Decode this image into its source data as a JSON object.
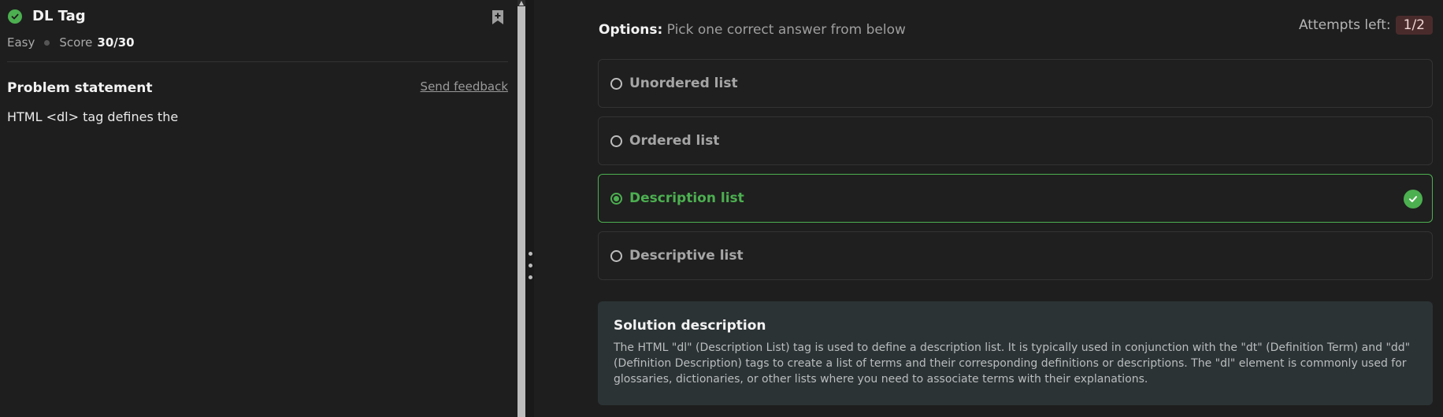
{
  "problem": {
    "title": "DL Tag",
    "difficulty": "Easy",
    "score_label": "Score",
    "score_value": "30/30",
    "statement_heading": "Problem statement",
    "feedback_link": "Send feedback",
    "statement": "HTML <dl> tag defines the"
  },
  "options": {
    "heading_bold": "Options:",
    "heading_rest": " Pick one correct answer from below",
    "attempts_label": "Attempts left:",
    "attempts_value": "1/2",
    "items": [
      {
        "label": "Unordered list",
        "selected": false
      },
      {
        "label": "Ordered list",
        "selected": false
      },
      {
        "label": "Description list",
        "selected": true
      },
      {
        "label": "Descriptive list",
        "selected": false
      }
    ]
  },
  "solution": {
    "heading": "Solution description",
    "text": "The HTML \"dl\" (Description List) tag is used to define a description list. It is typically used in conjunction with the \"dt\" (Definition Term) and \"dd\" (Definition Description) tags to create a list of terms and their corresponding definitions or descriptions. The \"dl\" element is commonly used for glossaries, dictionaries, or other lists where you need to associate terms with their explanations."
  },
  "colors": {
    "accent_green": "#4caf50",
    "attempts_badge_bg": "#4a2b2b",
    "solution_bg": "#2c3335"
  },
  "icons": [
    "check-circle-icon",
    "bookmark-add-icon",
    "radio-icon",
    "checkmark-icon"
  ]
}
